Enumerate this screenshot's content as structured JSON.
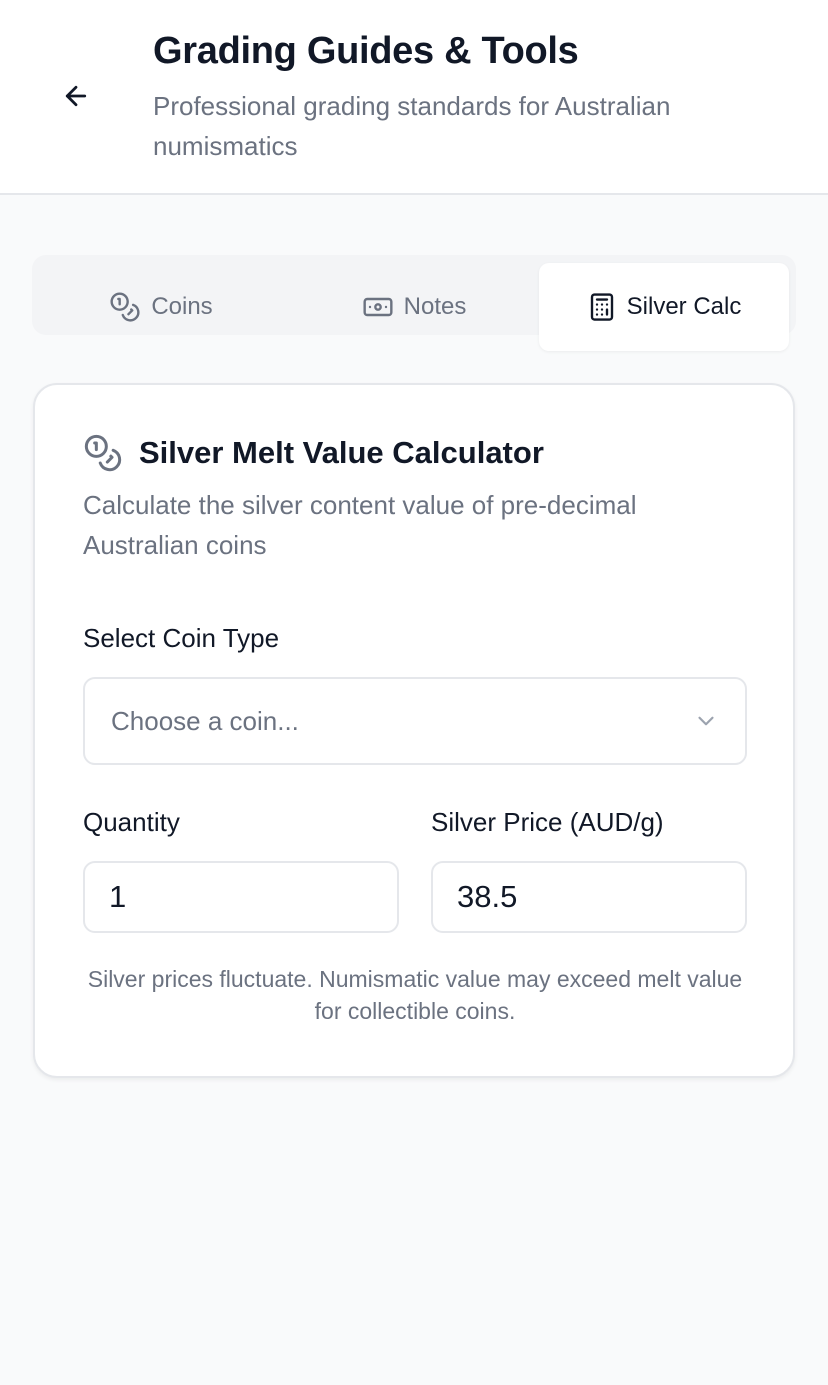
{
  "header": {
    "title": "Grading Guides & Tools",
    "subtitle": "Professional grading standards for Australian numismatics",
    "back_icon": "arrow-left-icon"
  },
  "tabs": [
    {
      "label": "Coins",
      "icon": "coins-icon",
      "active": false
    },
    {
      "label": "Notes",
      "icon": "banknote-icon",
      "active": false
    },
    {
      "label": "Silver Calc",
      "icon": "calculator-icon",
      "active": true
    }
  ],
  "calculator": {
    "icon": "coins-icon",
    "title": "Silver Melt Value Calculator",
    "description": "Calculate the silver content value of pre-decimal Australian coins",
    "coin_type": {
      "label": "Select Coin Type",
      "placeholder": "Choose a coin..."
    },
    "quantity": {
      "label": "Quantity",
      "value": "1"
    },
    "silver_price": {
      "label": "Silver Price (AUD/g)",
      "value": "38.5"
    },
    "note": "Silver prices fluctuate. Numismatic value may exceed melt value for collectible coins."
  },
  "colors": {
    "title": "#111827",
    "muted": "#6b7280",
    "border": "#e5e7eb",
    "background": "#f9fafb",
    "tab_track": "#f3f4f6"
  }
}
